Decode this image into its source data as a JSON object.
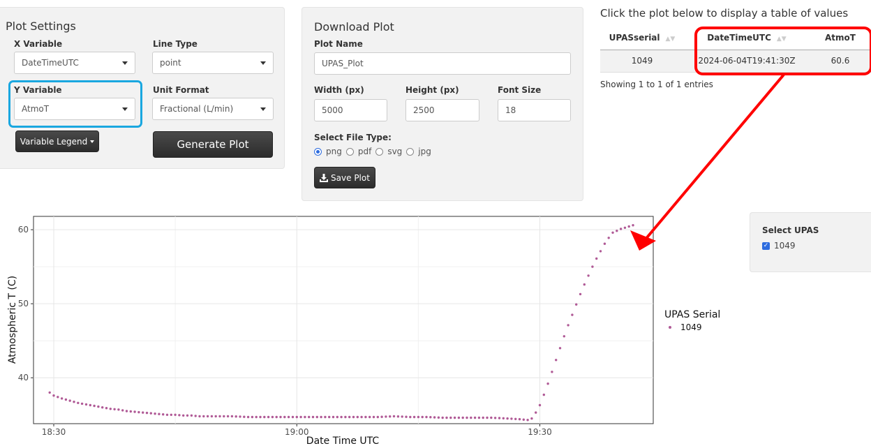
{
  "settings": {
    "title": "Plot Settings",
    "x_variable_label": "X Variable",
    "x_variable_value": "DateTimeUTC",
    "line_type_label": "Line Type",
    "line_type_value": "point",
    "y_variable_label": "Y Variable",
    "y_variable_value": "AtmoT",
    "unit_format_label": "Unit Format",
    "unit_format_value": "Fractional (L/min)",
    "legend_button": "Variable Legend",
    "generate_button": "Generate Plot"
  },
  "download": {
    "title": "Download Plot",
    "name_label": "Plot Name",
    "name_value": "UPAS_Plot",
    "width_label": "Width (px)",
    "width_value": "5000",
    "height_label": "Height (px)",
    "height_value": "2500",
    "font_label": "Font Size",
    "font_value": "18",
    "file_type_label": "Select File Type:",
    "file_types": [
      "png",
      "pdf",
      "svg",
      "jpg"
    ],
    "selected_file_type": "png",
    "save_button": "Save Plot"
  },
  "values_table": {
    "caption": "Click the plot below to display a table of values",
    "headers": [
      "UPASserial",
      "DateTimeUTC",
      "AtmoT"
    ],
    "rows": [
      [
        "1049",
        "2024-06-04T19:41:30Z",
        "60.6"
      ]
    ],
    "info": "Showing 1 to 1 of 1 entries"
  },
  "select_upas": {
    "title": "Select UPAS",
    "option": "1049",
    "checked": true
  },
  "colors": {
    "highlight_blue": "#1aa7e0",
    "highlight_red": "#ff0000",
    "series": "#b05a96"
  },
  "chart_data": {
    "type": "scatter",
    "xlabel": "Date Time UTC",
    "ylabel": "Atmospheric T (C)",
    "x_ticks": [
      "18:30",
      "19:00",
      "19:30"
    ],
    "y_ticks": [
      40,
      50,
      60
    ],
    "ylim": [
      33.8,
      61.8
    ],
    "xlim": [
      "18:27:30",
      "19:44:00"
    ],
    "legend_title": "UPAS Serial",
    "legend_position": "right",
    "grid": true,
    "series": [
      {
        "name": "1049",
        "points": [
          [
            "18:29:30",
            38.0
          ],
          [
            "18:30:00",
            37.6
          ],
          [
            "18:31:00",
            37.2
          ],
          [
            "18:32:00",
            36.9
          ],
          [
            "18:33:00",
            36.6
          ],
          [
            "18:34:00",
            36.4
          ],
          [
            "18:35:00",
            36.2
          ],
          [
            "18:36:00",
            36.0
          ],
          [
            "18:37:00",
            35.8
          ],
          [
            "18:38:00",
            35.7
          ],
          [
            "18:39:00",
            35.5
          ],
          [
            "18:40:00",
            35.4
          ],
          [
            "18:41:00",
            35.3
          ],
          [
            "18:42:00",
            35.2
          ],
          [
            "18:43:00",
            35.1
          ],
          [
            "18:44:00",
            35.0
          ],
          [
            "18:45:00",
            35.0
          ],
          [
            "18:46:00",
            34.9
          ],
          [
            "18:47:00",
            34.9
          ],
          [
            "18:48:00",
            34.8
          ],
          [
            "18:50:00",
            34.8
          ],
          [
            "18:52:00",
            34.8
          ],
          [
            "18:54:00",
            34.7
          ],
          [
            "18:56:00",
            34.7
          ],
          [
            "18:58:00",
            34.7
          ],
          [
            "19:00:00",
            34.7
          ],
          [
            "19:02:00",
            34.7
          ],
          [
            "19:04:00",
            34.7
          ],
          [
            "19:06:00",
            34.7
          ],
          [
            "19:08:00",
            34.7
          ],
          [
            "19:10:00",
            34.7
          ],
          [
            "19:12:00",
            34.8
          ],
          [
            "19:14:00",
            34.7
          ],
          [
            "19:16:00",
            34.7
          ],
          [
            "19:18:00",
            34.6
          ],
          [
            "19:20:00",
            34.6
          ],
          [
            "19:22:00",
            34.6
          ],
          [
            "19:24:00",
            34.6
          ],
          [
            "19:26:00",
            34.5
          ],
          [
            "19:27:30",
            34.4
          ],
          [
            "19:28:30",
            34.3
          ],
          [
            "19:29:00",
            34.5
          ],
          [
            "19:29:30",
            35.3
          ],
          [
            "19:30:00",
            36.3
          ],
          [
            "19:30:30",
            37.7
          ],
          [
            "19:31:00",
            39.2
          ],
          [
            "19:31:30",
            40.8
          ],
          [
            "19:32:00",
            42.4
          ],
          [
            "19:32:30",
            44.0
          ],
          [
            "19:33:00",
            45.6
          ],
          [
            "19:33:30",
            47.1
          ],
          [
            "19:34:00",
            48.5
          ],
          [
            "19:34:30",
            49.9
          ],
          [
            "19:35:00",
            51.3
          ],
          [
            "19:35:30",
            52.6
          ],
          [
            "19:36:00",
            53.8
          ],
          [
            "19:36:30",
            55.0
          ],
          [
            "19:37:00",
            56.1
          ],
          [
            "19:37:30",
            57.1
          ],
          [
            "19:38:00",
            58.1
          ],
          [
            "19:38:30",
            58.9
          ],
          [
            "19:39:00",
            59.6
          ],
          [
            "19:40:00",
            60.1
          ],
          [
            "19:41:30",
            60.6
          ]
        ]
      }
    ]
  }
}
